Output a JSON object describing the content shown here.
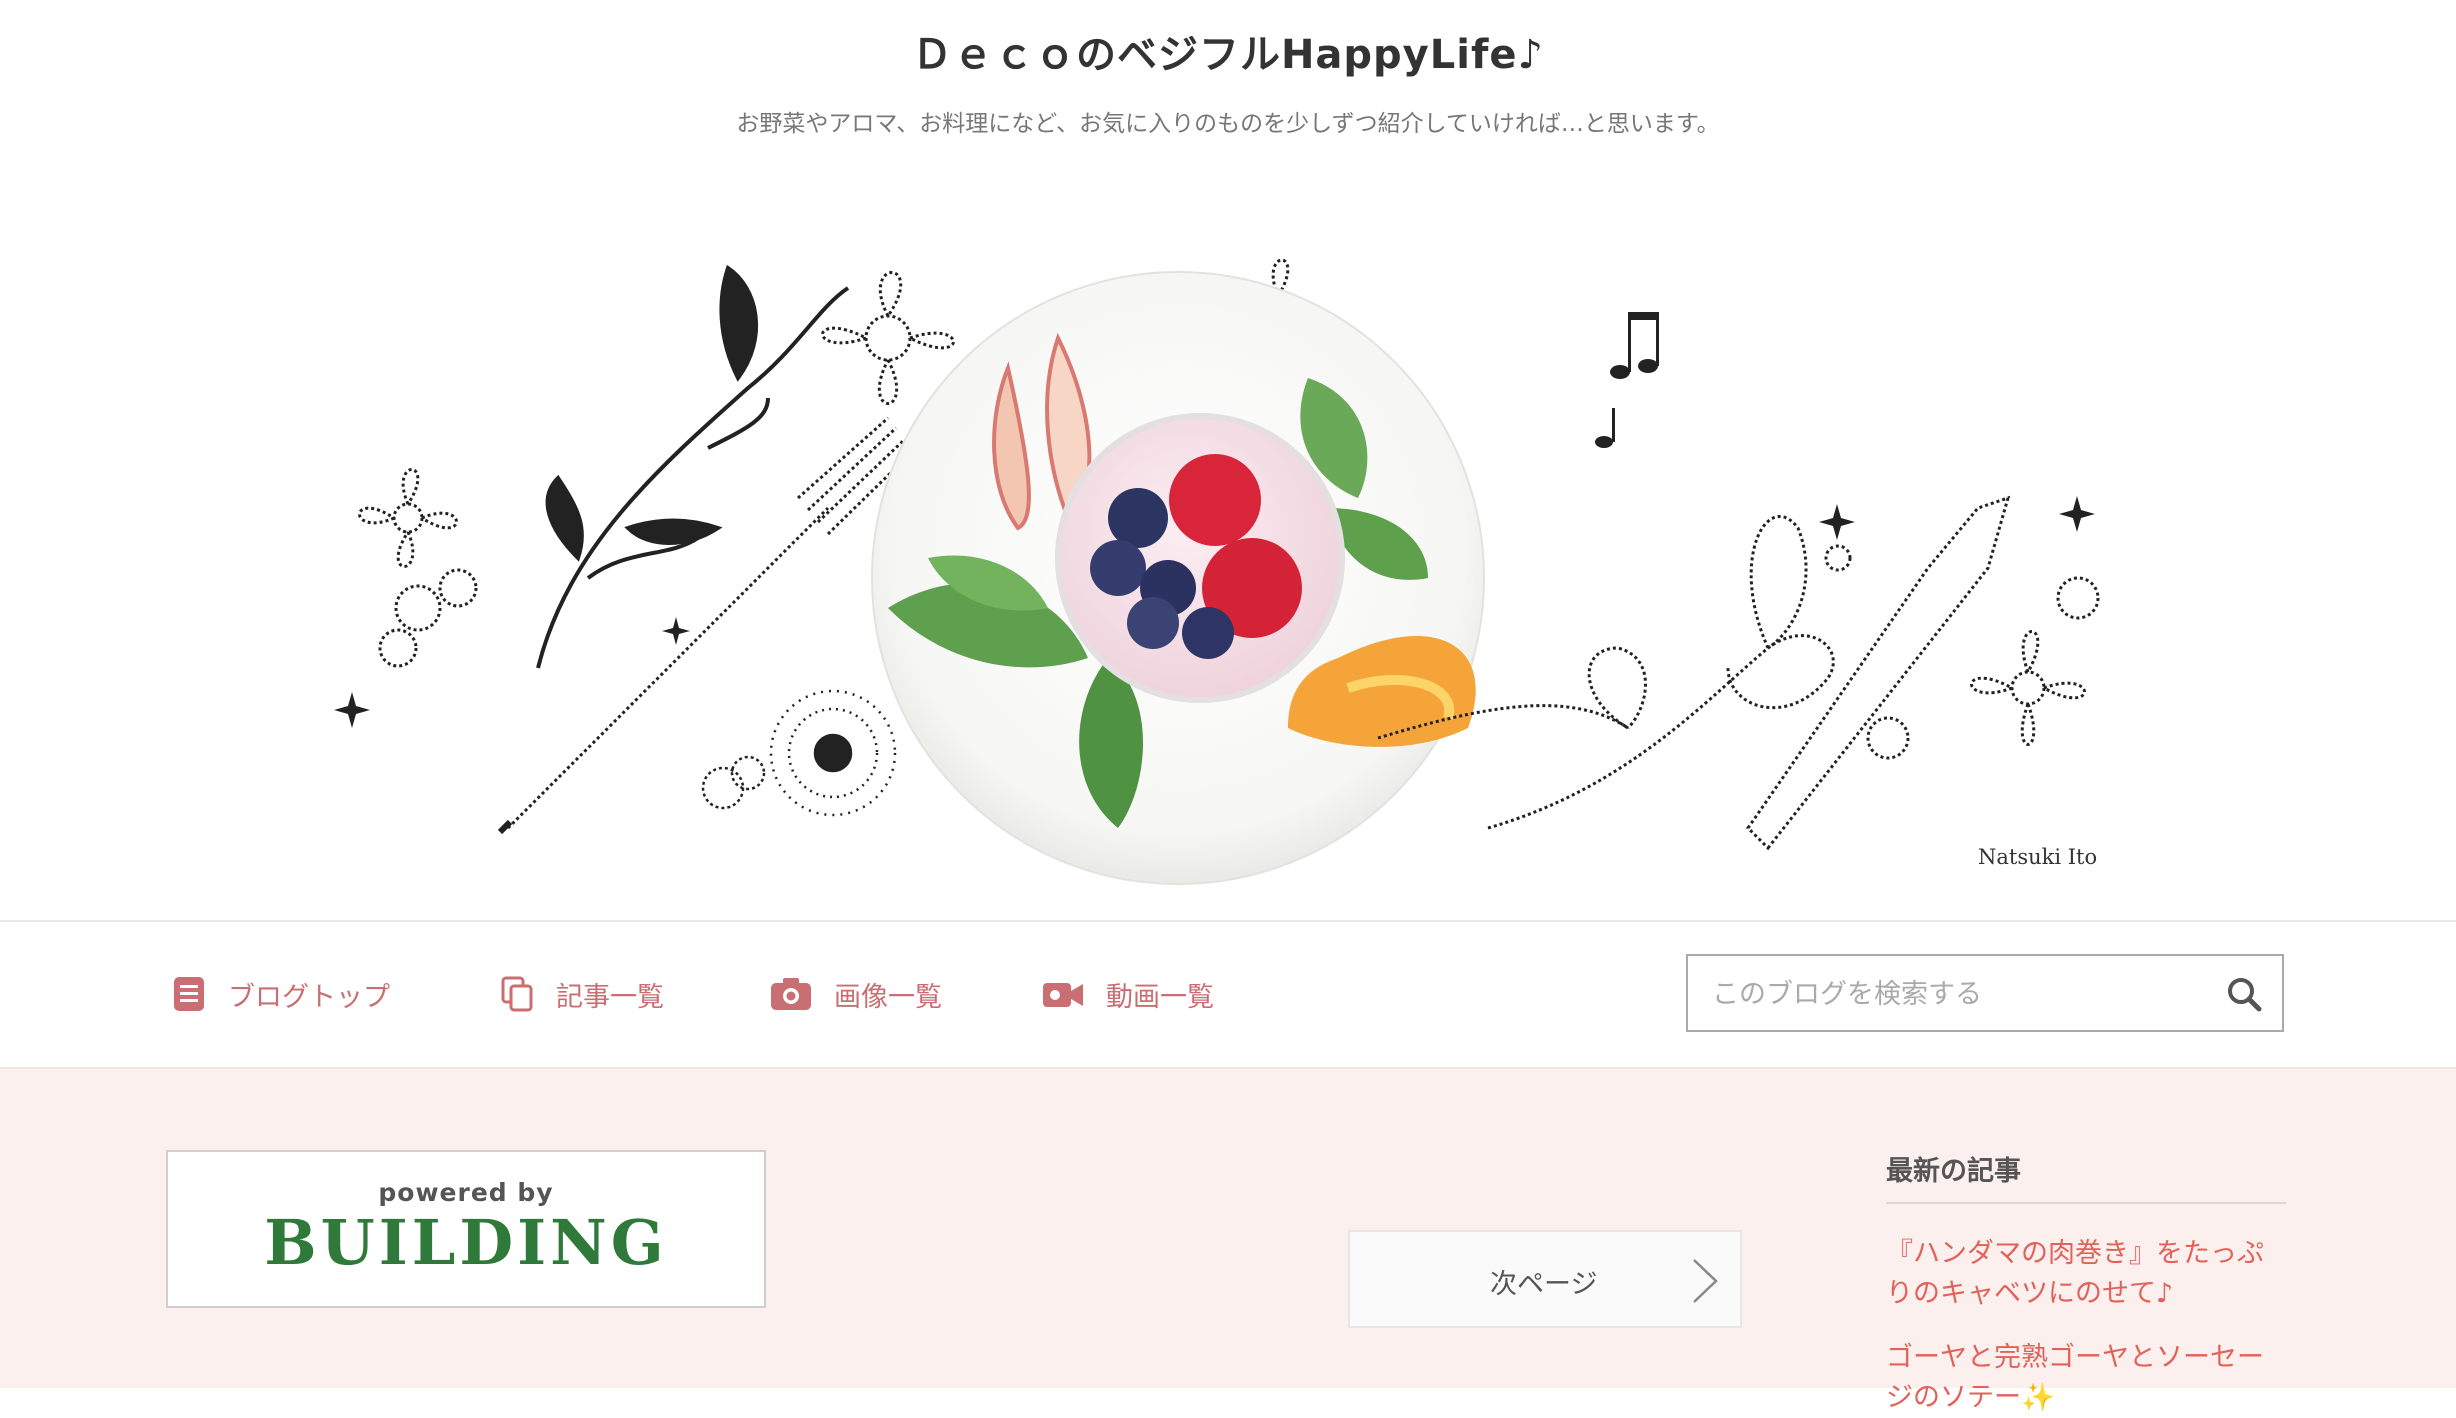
{
  "header": {
    "title": "ＤｅｃｏのベジフルHappyLife♪",
    "description": "お野菜やアロマ、お料理になど、お気に入りのものを少しずつ紹介していければ…と思います。",
    "hero_signature": "Natsuki Ito"
  },
  "nav": {
    "items": [
      {
        "label": "ブログトップ",
        "icon": "document-icon"
      },
      {
        "label": "記事一覧",
        "icon": "copy-icon"
      },
      {
        "label": "画像一覧",
        "icon": "camera-icon"
      },
      {
        "label": "動画一覧",
        "icon": "video-icon"
      }
    ],
    "search": {
      "placeholder": "このブログを検索する",
      "value": ""
    }
  },
  "main": {
    "powered_by": "powered by",
    "building": "BUILDING",
    "next_page": "次ページ"
  },
  "sidebar": {
    "heading": "最新の記事",
    "articles": [
      "『ハンダマの肉巻き』をたっぷりのキャベツにのせて♪",
      "ゴーヤと完熟ゴーヤとソーセージのソテー✨"
    ]
  },
  "colors": {
    "accent": "#c96e72",
    "link": "#e2625a",
    "main_bg": "#fcf0ee",
    "building_green": "#2f7a3a"
  }
}
